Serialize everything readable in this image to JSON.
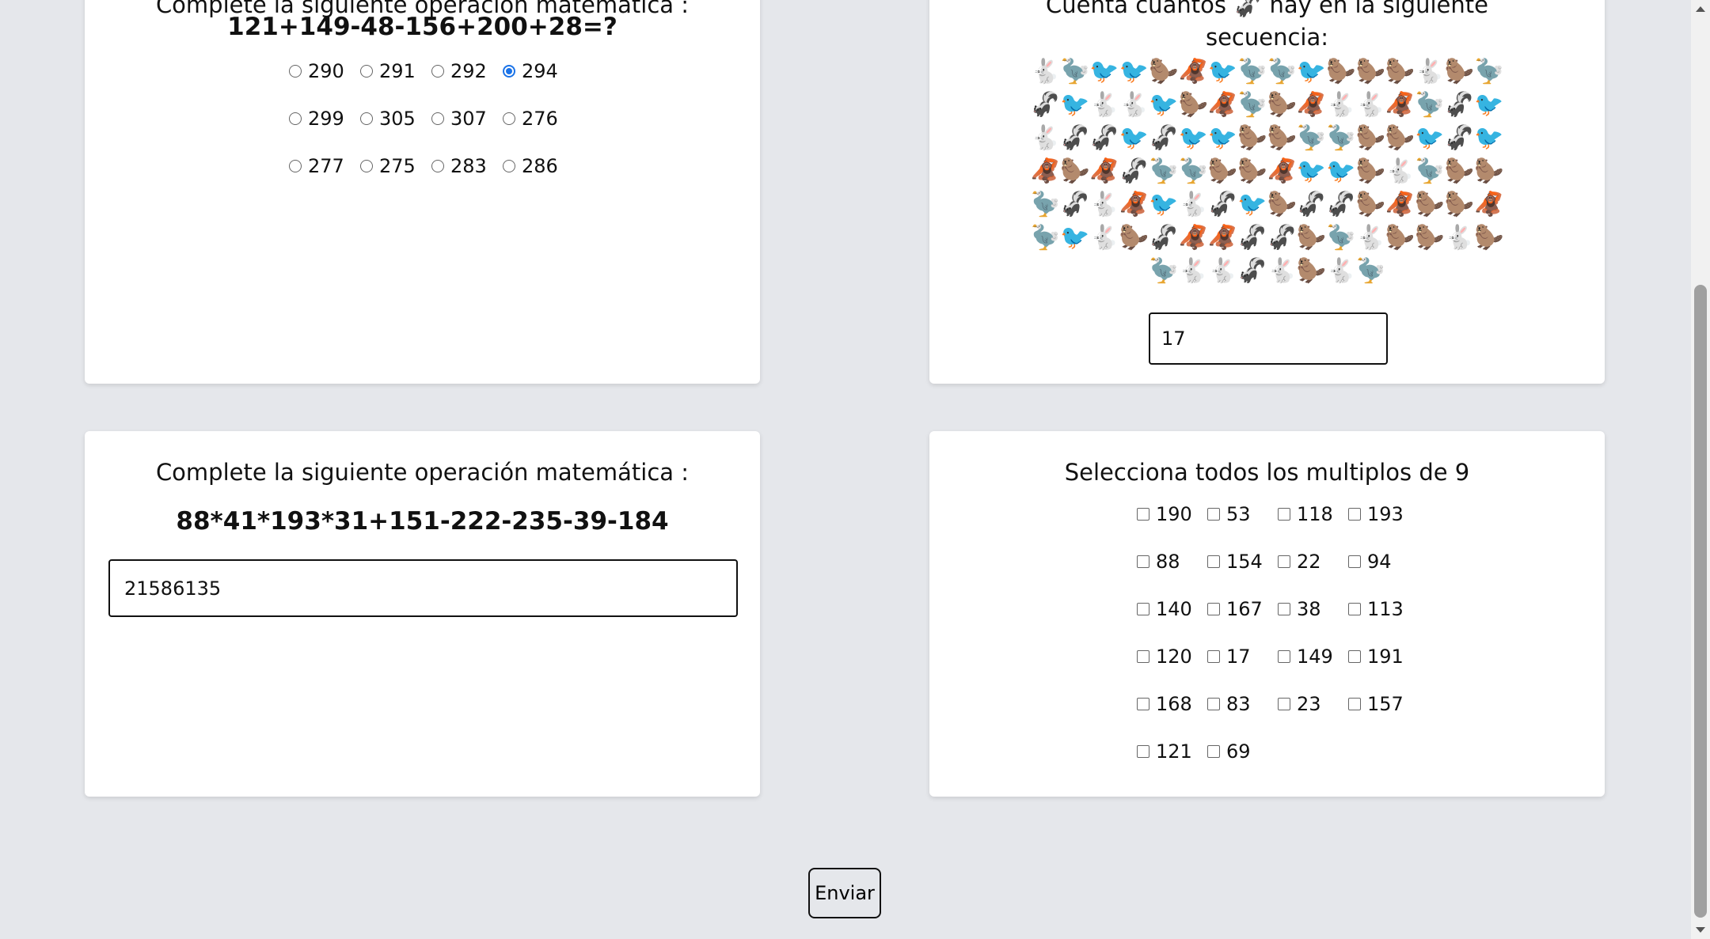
{
  "q1": {
    "title": "Complete la siguiente operación matemática :",
    "expression": "121+149-48-156+200+28=?",
    "options": [
      "290",
      "291",
      "292",
      "294",
      "299",
      "305",
      "307",
      "276",
      "277",
      "275",
      "283",
      "286"
    ],
    "selected": "294"
  },
  "q2": {
    "title_line1": "Cuenta cuantos 🦨 hay en la siguiente",
    "title_line2": "secuencia:",
    "sequence": "🐇🦤🐦🐦🦫🦧🐦🦤🦤🐦🦫🦫🦫🐇🦫🦤🦨🐦🐇🐇🐦🦫🦧🦤🦫🦧🐇🐇🦧🦤🦨🐦🐇🦨🦨🐦🦨🐦🐦🦫🦫🦤🦤🦫🦫🐦🦨🐦🦧🦫🦧🦨🦤🦤🦫🦫🦧🐦🐦🦫🐇🦤🦫🦫🦤🦨🐇🦧🐦🐇🦨🐦🦫🦨🦨🦫🦧🦫🦫🦧🦤🐦🐇🦫🦨🦧🦧🦨🦨🦫🦤🐇🦫🦫🐇🦫🦤🐇🐇🦨🐇🦫🐇🦤",
    "answer": "17"
  },
  "q3": {
    "title": "Complete la siguiente operación matemática :",
    "expression": "88*41*193*31+151-222-235-39-184",
    "answer": "21586135"
  },
  "q4": {
    "title": "Selecciona todos los multiplos de 9",
    "options": [
      "190",
      "53",
      "118",
      "193",
      "88",
      "154",
      "22",
      "94",
      "140",
      "167",
      "38",
      "113",
      "120",
      "17",
      "149",
      "191",
      "168",
      "83",
      "23",
      "157",
      "121",
      "69"
    ]
  },
  "submit": {
    "label": "Enviar"
  }
}
